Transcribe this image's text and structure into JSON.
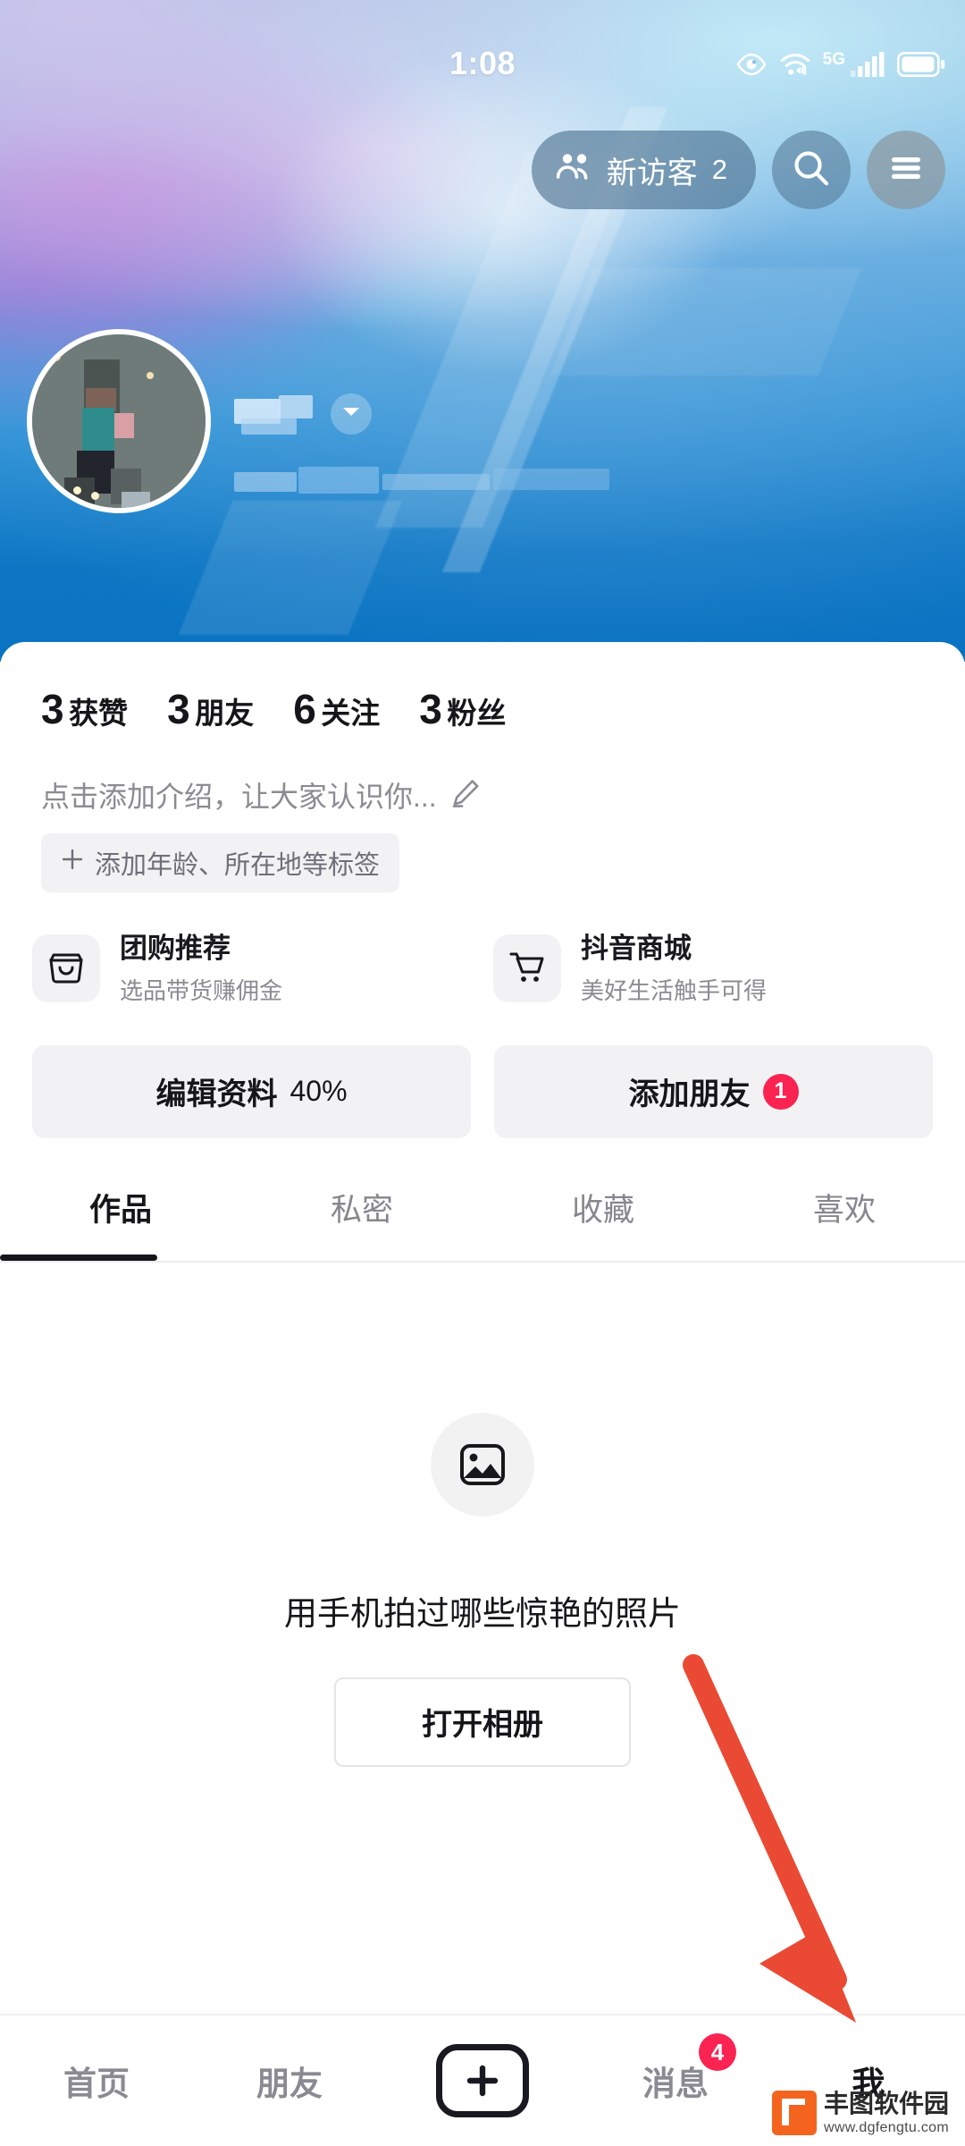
{
  "status_bar": {
    "time": "1:08",
    "network_label": "5G",
    "icons": [
      "eye-care-icon",
      "wifi-icon",
      "signal-bars-icon",
      "battery-icon"
    ]
  },
  "hero": {
    "visitor_pill": {
      "label": "新访客",
      "count": "2",
      "icon": "people-icon"
    },
    "search_icon": "search-icon",
    "menu_icon": "hamburger-menu-icon",
    "avatar": {
      "icon": "avatar-image",
      "censored": true
    },
    "username": "",
    "username_censored": true,
    "subtitle_censored": true,
    "name_chevron_icon": "chevron-down-icon"
  },
  "profile": {
    "stats": [
      {
        "num": "3",
        "label": "获赞"
      },
      {
        "num": "3",
        "label": "朋友"
      },
      {
        "num": "6",
        "label": "关注"
      },
      {
        "num": "3",
        "label": "粉丝"
      }
    ],
    "bio_placeholder": "点击添加介绍，让大家认识你...",
    "bio_edit_icon": "pencil-icon",
    "tag_add_label": "添加年龄、所在地等标签",
    "tag_plus_icon": "plus-icon",
    "promos": [
      {
        "icon": "storefront-icon",
        "title": "团购推荐",
        "subtitle": "选品带货赚佣金"
      },
      {
        "icon": "shopping-cart-icon",
        "title": "抖音商城",
        "subtitle": "美好生活触手可得"
      }
    ],
    "actions": [
      {
        "label": "编辑资料",
        "value": "40%",
        "badge": ""
      },
      {
        "label": "添加朋友",
        "value": "",
        "badge": "1"
      }
    ]
  },
  "tabs": [
    {
      "label": "作品",
      "active": true
    },
    {
      "label": "私密",
      "active": false
    },
    {
      "label": "收藏",
      "active": false
    },
    {
      "label": "喜欢",
      "active": false
    }
  ],
  "empty_state": {
    "icon": "image-placeholder-icon",
    "title": "用手机拍过哪些惊艳的照片",
    "button_label": "打开相册"
  },
  "bottom_nav": [
    {
      "label": "首页",
      "active": false,
      "badge": ""
    },
    {
      "label": "朋友",
      "active": false,
      "badge": ""
    },
    {
      "label": "",
      "active": false,
      "badge": "",
      "icon": "plus-create-icon"
    },
    {
      "label": "消息",
      "active": false,
      "badge": "4"
    },
    {
      "label": "我",
      "active": true,
      "badge": ""
    }
  ],
  "annotation": {
    "arrow_color": "#ea4a33",
    "arrow_target": "bottom-nav-me-tab"
  },
  "watermark": {
    "name": "丰图软件园",
    "url": "www.dgfengtu.com",
    "color": "#f4641e"
  }
}
